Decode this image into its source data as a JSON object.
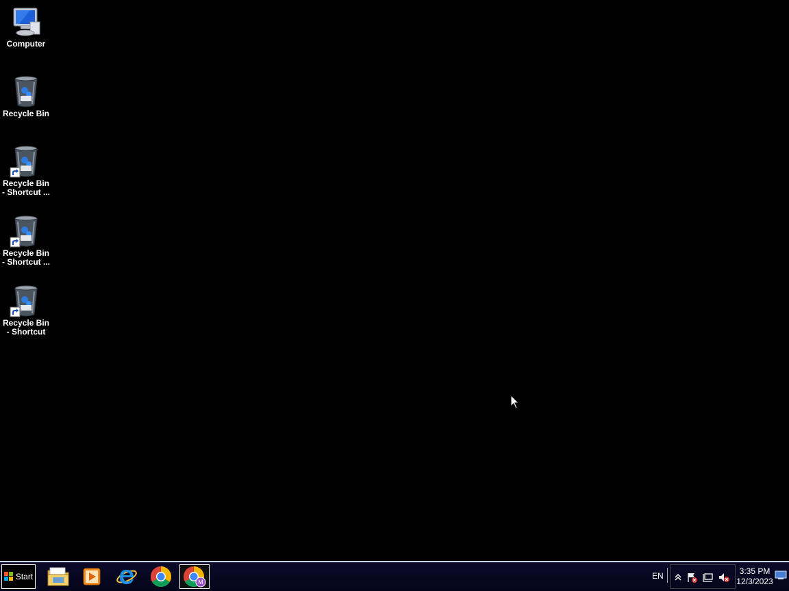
{
  "desktop": {
    "icons": [
      {
        "label_lines": [
          "Computer"
        ],
        "kind": "computer",
        "shortcut": false
      },
      {
        "label_lines": [
          "Recycle Bin"
        ],
        "kind": "recycle-bin",
        "shortcut": false
      },
      {
        "label_lines": [
          "Recycle Bin",
          "- Shortcut ..."
        ],
        "kind": "recycle-bin",
        "shortcut": true
      },
      {
        "label_lines": [
          "Recycle Bin",
          "- Shortcut ..."
        ],
        "kind": "recycle-bin",
        "shortcut": true
      },
      {
        "label_lines": [
          "Recycle Bin",
          "- Shortcut"
        ],
        "kind": "recycle-bin",
        "shortcut": true
      }
    ]
  },
  "taskbar": {
    "start_label": "Start",
    "pinned": [
      "file-explorer-icon",
      "media-player-icon",
      "internet-explorer-icon",
      "chrome-icon",
      "chrome-profile-icon"
    ],
    "active_index": 4,
    "language": "EN",
    "clock": {
      "time": "3:35 PM",
      "date": "12/3/2023"
    },
    "tray_icons": [
      "show-hidden-icons-chevron-icon",
      "action-center-flag-icon",
      "network-icon",
      "volume-muted-icon"
    ]
  },
  "colors": {
    "desktop_bg": "#000000",
    "taskbar_bg": "#06061f",
    "taskbar_border": "#c9d4f0"
  }
}
